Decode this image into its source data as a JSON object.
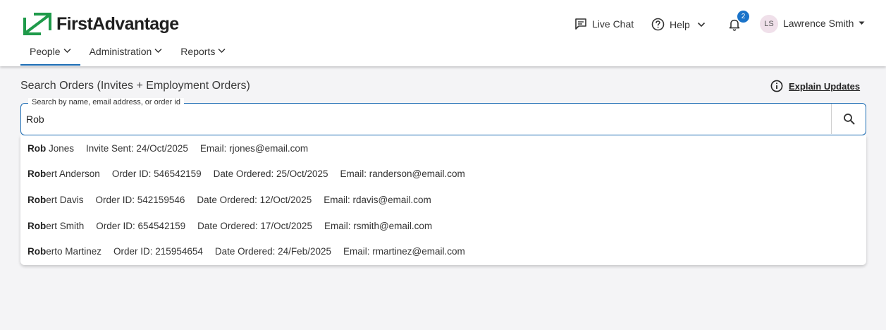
{
  "brand": {
    "name": "FirstAdvantage",
    "color": "#1f9a4a"
  },
  "header": {
    "live_chat": "Live Chat",
    "help": "Help",
    "notifications_count": "2",
    "user_initials": "LS",
    "user_name": "Lawrence Smith"
  },
  "nav": {
    "items": [
      {
        "label": "People"
      },
      {
        "label": "Administration"
      },
      {
        "label": "Reports"
      }
    ]
  },
  "page": {
    "title": "Search Orders (Invites + Employment Orders)",
    "explain_updates": "Explain Updates"
  },
  "search": {
    "label": "Search by name, email address, or order id",
    "value": "Rob"
  },
  "results": [
    {
      "match": "Rob",
      "rest": " Jones",
      "f1": "Invite Sent: 24/Oct/2025",
      "f2": "Email: rjones@email.com",
      "f3": ""
    },
    {
      "match": "Rob",
      "rest": "ert Anderson",
      "f1": "Order ID: 546542159",
      "f2": "Date Ordered: 25/Oct/2025",
      "f3": "Email: randerson@email.com"
    },
    {
      "match": "Rob",
      "rest": "ert Davis",
      "f1": "Order ID: 542159546",
      "f2": "Date Ordered: 12/Oct/2025",
      "f3": "Email: rdavis@email.com"
    },
    {
      "match": "Rob",
      "rest": "ert Smith",
      "f1": "Order ID: 654542159",
      "f2": "Date Ordered: 17/Oct/2025",
      "f3": "Email: rsmith@email.com"
    },
    {
      "match": "Rob",
      "rest": "erto Martinez",
      "f1": "Order ID: 215954654",
      "f2": "Date Ordered: 24/Feb/2025",
      "f3": "Email: rmartinez@email.com"
    }
  ],
  "colors": {
    "accent": "#1a6bb3",
    "badge": "#1a73c9",
    "avatar_bg": "#f0e0ea"
  }
}
